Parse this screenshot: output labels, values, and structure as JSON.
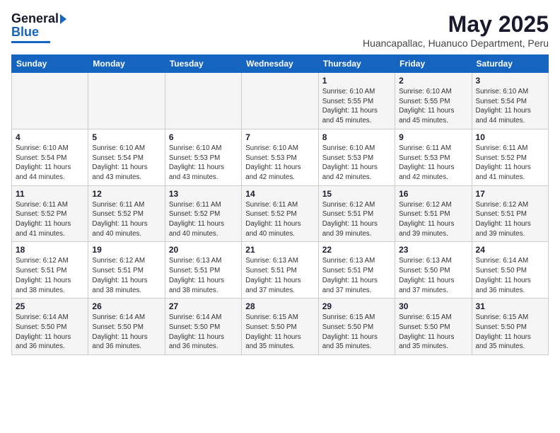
{
  "header": {
    "logo_general": "General",
    "logo_blue": "Blue",
    "title": "May 2025",
    "subtitle": "Huancapallac, Huanuco Department, Peru"
  },
  "weekdays": [
    "Sunday",
    "Monday",
    "Tuesday",
    "Wednesday",
    "Thursday",
    "Friday",
    "Saturday"
  ],
  "weeks": [
    [
      {
        "day": "",
        "info": ""
      },
      {
        "day": "",
        "info": ""
      },
      {
        "day": "",
        "info": ""
      },
      {
        "day": "",
        "info": ""
      },
      {
        "day": "1",
        "info": "Sunrise: 6:10 AM\nSunset: 5:55 PM\nDaylight: 11 hours\nand 45 minutes."
      },
      {
        "day": "2",
        "info": "Sunrise: 6:10 AM\nSunset: 5:55 PM\nDaylight: 11 hours\nand 45 minutes."
      },
      {
        "day": "3",
        "info": "Sunrise: 6:10 AM\nSunset: 5:54 PM\nDaylight: 11 hours\nand 44 minutes."
      }
    ],
    [
      {
        "day": "4",
        "info": "Sunrise: 6:10 AM\nSunset: 5:54 PM\nDaylight: 11 hours\nand 44 minutes."
      },
      {
        "day": "5",
        "info": "Sunrise: 6:10 AM\nSunset: 5:54 PM\nDaylight: 11 hours\nand 43 minutes."
      },
      {
        "day": "6",
        "info": "Sunrise: 6:10 AM\nSunset: 5:53 PM\nDaylight: 11 hours\nand 43 minutes."
      },
      {
        "day": "7",
        "info": "Sunrise: 6:10 AM\nSunset: 5:53 PM\nDaylight: 11 hours\nand 42 minutes."
      },
      {
        "day": "8",
        "info": "Sunrise: 6:10 AM\nSunset: 5:53 PM\nDaylight: 11 hours\nand 42 minutes."
      },
      {
        "day": "9",
        "info": "Sunrise: 6:11 AM\nSunset: 5:53 PM\nDaylight: 11 hours\nand 42 minutes."
      },
      {
        "day": "10",
        "info": "Sunrise: 6:11 AM\nSunset: 5:52 PM\nDaylight: 11 hours\nand 41 minutes."
      }
    ],
    [
      {
        "day": "11",
        "info": "Sunrise: 6:11 AM\nSunset: 5:52 PM\nDaylight: 11 hours\nand 41 minutes."
      },
      {
        "day": "12",
        "info": "Sunrise: 6:11 AM\nSunset: 5:52 PM\nDaylight: 11 hours\nand 40 minutes."
      },
      {
        "day": "13",
        "info": "Sunrise: 6:11 AM\nSunset: 5:52 PM\nDaylight: 11 hours\nand 40 minutes."
      },
      {
        "day": "14",
        "info": "Sunrise: 6:11 AM\nSunset: 5:52 PM\nDaylight: 11 hours\nand 40 minutes."
      },
      {
        "day": "15",
        "info": "Sunrise: 6:12 AM\nSunset: 5:51 PM\nDaylight: 11 hours\nand 39 minutes."
      },
      {
        "day": "16",
        "info": "Sunrise: 6:12 AM\nSunset: 5:51 PM\nDaylight: 11 hours\nand 39 minutes."
      },
      {
        "day": "17",
        "info": "Sunrise: 6:12 AM\nSunset: 5:51 PM\nDaylight: 11 hours\nand 39 minutes."
      }
    ],
    [
      {
        "day": "18",
        "info": "Sunrise: 6:12 AM\nSunset: 5:51 PM\nDaylight: 11 hours\nand 38 minutes."
      },
      {
        "day": "19",
        "info": "Sunrise: 6:12 AM\nSunset: 5:51 PM\nDaylight: 11 hours\nand 38 minutes."
      },
      {
        "day": "20",
        "info": "Sunrise: 6:13 AM\nSunset: 5:51 PM\nDaylight: 11 hours\nand 38 minutes."
      },
      {
        "day": "21",
        "info": "Sunrise: 6:13 AM\nSunset: 5:51 PM\nDaylight: 11 hours\nand 37 minutes."
      },
      {
        "day": "22",
        "info": "Sunrise: 6:13 AM\nSunset: 5:51 PM\nDaylight: 11 hours\nand 37 minutes."
      },
      {
        "day": "23",
        "info": "Sunrise: 6:13 AM\nSunset: 5:50 PM\nDaylight: 11 hours\nand 37 minutes."
      },
      {
        "day": "24",
        "info": "Sunrise: 6:14 AM\nSunset: 5:50 PM\nDaylight: 11 hours\nand 36 minutes."
      }
    ],
    [
      {
        "day": "25",
        "info": "Sunrise: 6:14 AM\nSunset: 5:50 PM\nDaylight: 11 hours\nand 36 minutes."
      },
      {
        "day": "26",
        "info": "Sunrise: 6:14 AM\nSunset: 5:50 PM\nDaylight: 11 hours\nand 36 minutes."
      },
      {
        "day": "27",
        "info": "Sunrise: 6:14 AM\nSunset: 5:50 PM\nDaylight: 11 hours\nand 36 minutes."
      },
      {
        "day": "28",
        "info": "Sunrise: 6:15 AM\nSunset: 5:50 PM\nDaylight: 11 hours\nand 35 minutes."
      },
      {
        "day": "29",
        "info": "Sunrise: 6:15 AM\nSunset: 5:50 PM\nDaylight: 11 hours\nand 35 minutes."
      },
      {
        "day": "30",
        "info": "Sunrise: 6:15 AM\nSunset: 5:50 PM\nDaylight: 11 hours\nand 35 minutes."
      },
      {
        "day": "31",
        "info": "Sunrise: 6:15 AM\nSunset: 5:50 PM\nDaylight: 11 hours\nand 35 minutes."
      }
    ]
  ]
}
